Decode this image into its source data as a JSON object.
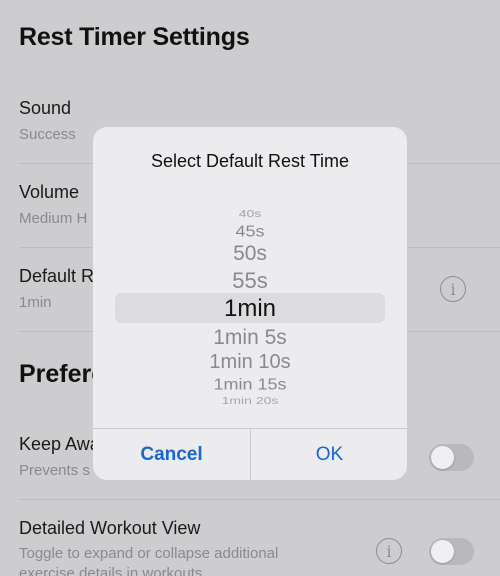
{
  "page": {
    "title": "Rest Timer Settings"
  },
  "rows": {
    "sound": {
      "title": "Sound",
      "value": "Success"
    },
    "volume": {
      "title": "Volume",
      "value": "Medium H"
    },
    "default_rest": {
      "title": "Default R",
      "value": "1min"
    }
  },
  "preferences": {
    "section_title": "Prefere",
    "keep_awake": {
      "title": "Keep Awa",
      "desc": "Prevents s",
      "enabled": false
    },
    "detailed_view": {
      "title": "Detailed Workout View",
      "desc_line1": "Toggle to expand or collapse additional",
      "desc_line2": "exercise details in workouts",
      "enabled": false
    }
  },
  "dialog": {
    "title": "Select Default Rest Time",
    "options": [
      "40s",
      "45s",
      "50s",
      "55s",
      "1min",
      "1min 5s",
      "1min 10s",
      "1min 15s",
      "1min 20s"
    ],
    "selected": "1min",
    "cancel_label": "Cancel",
    "ok_label": "OK"
  },
  "colors": {
    "accent": "#1a66d4",
    "background": "#cdcdcf",
    "dialog": "#ececee"
  },
  "icons": {
    "info": "info-circle-icon"
  }
}
